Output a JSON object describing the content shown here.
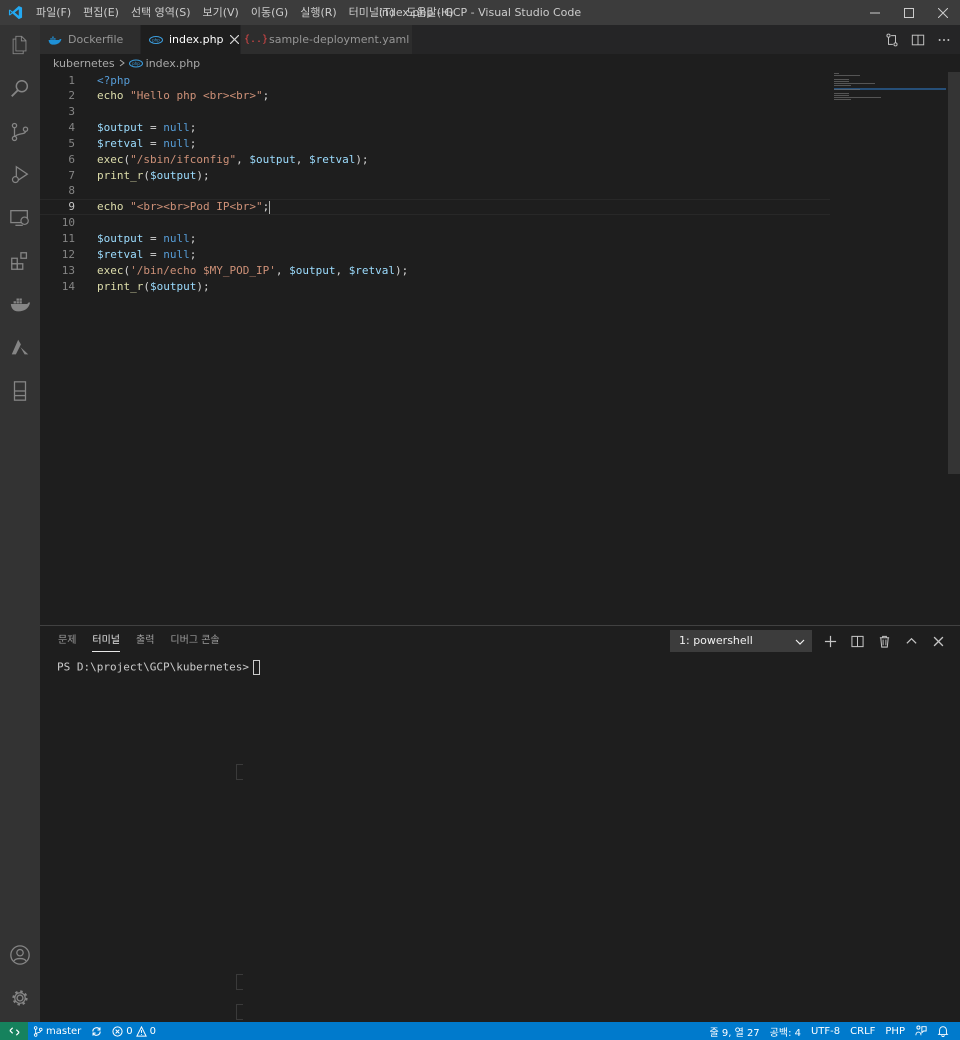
{
  "window": {
    "title": "index.php - GCP - Visual Studio Code",
    "menu": [
      "파일(F)",
      "편집(E)",
      "선택 영역(S)",
      "보기(V)",
      "이동(G)",
      "실행(R)",
      "터미널(T)",
      "도움말(H)"
    ]
  },
  "tabs": [
    {
      "label": "Dockerfile",
      "icon": "docker-icon",
      "active": false
    },
    {
      "label": "index.php",
      "icon": "php-icon",
      "active": true
    },
    {
      "label": "sample-deployment.yaml",
      "icon": "braces-icon",
      "active": false
    }
  ],
  "breadcrumb": {
    "folder": "kubernetes",
    "file": "index.php"
  },
  "editor": {
    "language": "php",
    "current_line": 9,
    "lines": [
      {
        "n": "1",
        "text": "<?php"
      },
      {
        "n": "2",
        "text": "echo \"Hello php <br><br>\";"
      },
      {
        "n": "3",
        "text": ""
      },
      {
        "n": "4",
        "text": "$output = null;"
      },
      {
        "n": "5",
        "text": "$retval = null;"
      },
      {
        "n": "6",
        "text": "exec(\"/sbin/ifconfig\", $output, $retval);"
      },
      {
        "n": "7",
        "text": "print_r($output);"
      },
      {
        "n": "8",
        "text": ""
      },
      {
        "n": "9",
        "text": "echo \"<br><br>Pod IP<br>\";"
      },
      {
        "n": "10",
        "text": ""
      },
      {
        "n": "11",
        "text": "$output = null;"
      },
      {
        "n": "12",
        "text": "$retval = null;"
      },
      {
        "n": "13",
        "text": "exec('/bin/echo $MY_POD_IP', $output, $retval);"
      },
      {
        "n": "14",
        "text": "print_r($output);"
      }
    ]
  },
  "panel": {
    "tabs": [
      "문제",
      "터미널",
      "출력",
      "디버그 콘솔"
    ],
    "active_tab": "터미널",
    "terminal_select": "1: powershell",
    "prompt": "PS D:\\project\\GCP\\kubernetes>"
  },
  "statusbar": {
    "branch": "master",
    "errors": "0",
    "warnings": "0",
    "position": "줄 9, 열 27",
    "indent": "공백: 4",
    "encoding": "UTF-8",
    "eol": "CRLF",
    "language": "PHP"
  },
  "colors": {
    "statusbar": "#007acc",
    "activitybar": "#333333",
    "editor_bg": "#1e1e1e",
    "titlebar": "#3c3c3c"
  }
}
